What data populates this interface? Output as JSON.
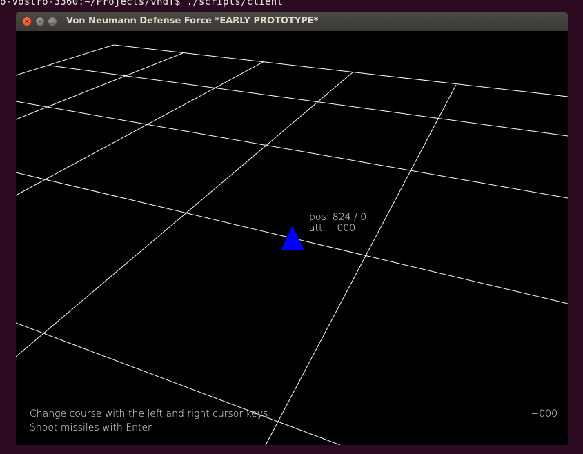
{
  "terminal": {
    "prompt_text": "o-Vostro-3360:~/Projects/vndf$ ./scripts/client"
  },
  "window": {
    "title": "Von Neumann Defense Force *EARLY PROTOTYPE*",
    "buttons": {
      "close_glyph": "×",
      "minimize_glyph": "–",
      "maximize_glyph": "□"
    }
  },
  "hud": {
    "pos_label": "pos:",
    "pos_x": "824",
    "pos_sep": "/",
    "pos_y": "0",
    "att_label": "att:",
    "att_value": "+000",
    "help_line_1": "Change course with the left and right cursor keys",
    "help_line_2": "Shoot missiles with Enter",
    "score": "+000"
  },
  "colors": {
    "background": "#000000",
    "grid_lines": "#ffffff",
    "ship": "#0000ff",
    "desktop": "#2c0a1f"
  },
  "ship": {
    "shape": "triangle-icon"
  }
}
